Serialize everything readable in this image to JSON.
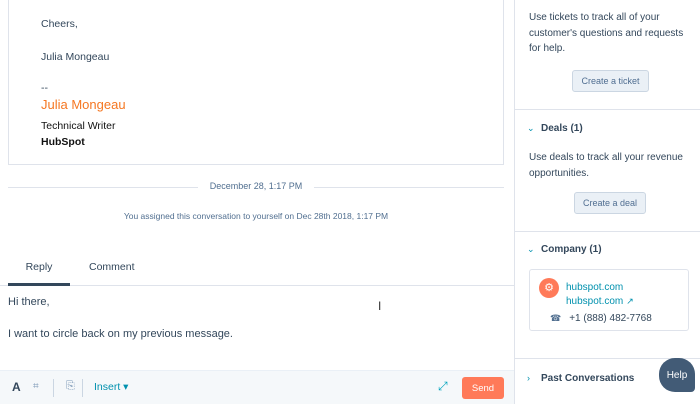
{
  "email": {
    "closing": "Cheers,",
    "signer": "Julia Mongeau",
    "dashes": "--",
    "signature_name": "Julia Mongeau",
    "signature_title": "Technical Writer",
    "signature_company": "HubSpot"
  },
  "timeline": {
    "date": "December 28, 1:17 PM",
    "assigned_text": "You assigned this conversation to yourself on Dec 28th 2018, 1:17 PM"
  },
  "tabs": [
    {
      "label": "Reply",
      "active": true
    },
    {
      "label": "Comment",
      "active": false
    }
  ],
  "editor": {
    "line1": "Hi there,",
    "line2": "I want to circle back on my previous message."
  },
  "toolbar": {
    "format_label": "A",
    "snippet_label": "⌗",
    "attach_label": "⎘",
    "insert_label": "Insert ▾",
    "expand_label": "⤢",
    "send_label": "Send"
  },
  "sidebar": {
    "tickets_text": "Use tickets to track all of your customer's questions and requests for help.",
    "create_ticket_label": "Create a ticket",
    "deals_header": "Deals (1)",
    "deals_text": "Use deals to track all your revenue opportunities.",
    "create_deal_label": "Create a deal",
    "company_header": "Company (1)",
    "company_logo": "⚙",
    "company_domain": "hubspot.com",
    "company_link": "hubspot.com",
    "company_phone": "+1 (888) 482-7768",
    "past_conversations_header": "Past Conversations",
    "chevron_expanded": "⌄",
    "chevron_collapsed": "›"
  },
  "help_label": "Help",
  "colors": {
    "accent": "#ff7a59",
    "link": "#0091ae",
    "signature": "#f57722",
    "text": "#33475b"
  }
}
